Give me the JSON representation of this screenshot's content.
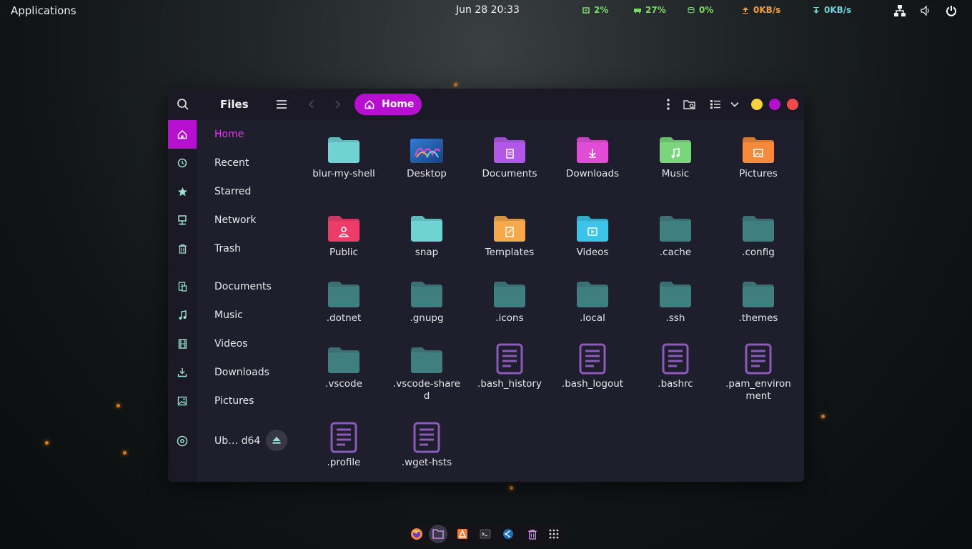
{
  "topbar": {
    "applications": "Applications",
    "clock": "Jun 28  20:33",
    "stats": [
      {
        "icon": "cpu-icon",
        "value": "2%",
        "color": "#7bd96a"
      },
      {
        "icon": "ram-icon",
        "value": "27%",
        "color": "#7bd96a"
      },
      {
        "icon": "disk-icon",
        "value": "0%",
        "color": "#7bd96a"
      },
      {
        "icon": "upload-icon",
        "value": "0KB/s",
        "color": "#f0a040"
      },
      {
        "icon": "download-icon",
        "value": "0KB/s",
        "color": "#6ad1d9"
      }
    ]
  },
  "window": {
    "title": "Files",
    "location": "Home",
    "accent": "#b70fcf",
    "buttons": {
      "minimize": "#f5d33a",
      "maximize": "#b70fcf",
      "close": "#f04a4a"
    }
  },
  "sidebar": {
    "places": [
      {
        "label": "Home",
        "icon": "home-icon",
        "active": true
      },
      {
        "label": "Recent",
        "icon": "clock-icon"
      },
      {
        "label": "Starred",
        "icon": "star-icon"
      },
      {
        "label": "Network",
        "icon": "network-icon"
      },
      {
        "label": "Trash",
        "icon": "trash-icon"
      }
    ],
    "bookmarks": [
      {
        "label": "Documents",
        "icon": "document-icon"
      },
      {
        "label": "Music",
        "icon": "music-icon"
      },
      {
        "label": "Videos",
        "icon": "film-icon"
      },
      {
        "label": "Downloads",
        "icon": "download-icon"
      },
      {
        "label": "Pictures",
        "icon": "image-icon"
      }
    ],
    "device": {
      "label": "Ub… d64",
      "icon": "disc-icon"
    }
  },
  "files": [
    {
      "name": "blur-my-shell",
      "kind": "folder",
      "color": "#6fd3d3"
    },
    {
      "name": "Desktop",
      "kind": "desktop"
    },
    {
      "name": "Documents",
      "kind": "folder",
      "color": "#b158e8",
      "emblem": "doc"
    },
    {
      "name": "Downloads",
      "kind": "folder",
      "color": "#e04cd6",
      "emblem": "down"
    },
    {
      "name": "Music",
      "kind": "folder",
      "color": "#7ad67a",
      "emblem": "music"
    },
    {
      "name": "Pictures",
      "kind": "folder",
      "color": "#f58a3a",
      "emblem": "pic"
    },
    {
      "name": "Public",
      "kind": "folder",
      "color": "#ec3d6a",
      "emblem": "user"
    },
    {
      "name": "snap",
      "kind": "folder",
      "color": "#6fd3d3"
    },
    {
      "name": "Templates",
      "kind": "folder",
      "color": "#f7a84a",
      "emblem": "tmpl"
    },
    {
      "name": "Videos",
      "kind": "folder",
      "color": "#3cc3e8",
      "emblem": "play"
    },
    {
      "name": ".cache",
      "kind": "folder",
      "color": "#3f7f80"
    },
    {
      "name": ".config",
      "kind": "folder",
      "color": "#3f7f80"
    },
    {
      "name": ".dotnet",
      "kind": "folder",
      "color": "#3f7f80"
    },
    {
      "name": ".gnupg",
      "kind": "folder",
      "color": "#3f7f80"
    },
    {
      "name": ".icons",
      "kind": "folder",
      "color": "#3f7f80"
    },
    {
      "name": ".local",
      "kind": "folder",
      "color": "#3f7f80"
    },
    {
      "name": ".ssh",
      "kind": "folder",
      "color": "#3f7f80"
    },
    {
      "name": ".themes",
      "kind": "folder",
      "color": "#3f7f80"
    },
    {
      "name": ".vscode",
      "kind": "folder",
      "color": "#3f7f80"
    },
    {
      "name": ".vscode-shared",
      "kind": "folder",
      "color": "#3f7f80"
    },
    {
      "name": ".bash_history",
      "kind": "text"
    },
    {
      "name": ".bash_logout",
      "kind": "text"
    },
    {
      "name": ".bashrc",
      "kind": "text"
    },
    {
      "name": ".pam_environment",
      "kind": "text"
    },
    {
      "name": ".profile",
      "kind": "text"
    },
    {
      "name": ".wget-hsts",
      "kind": "text"
    }
  ],
  "dock": [
    {
      "name": "firefox-icon"
    },
    {
      "name": "files-icon",
      "active": true
    },
    {
      "name": "software-icon"
    },
    {
      "name": "terminal-icon"
    },
    {
      "name": "vscode-icon"
    },
    {
      "name": "trash-icon"
    },
    {
      "name": "app-grid-icon"
    }
  ]
}
